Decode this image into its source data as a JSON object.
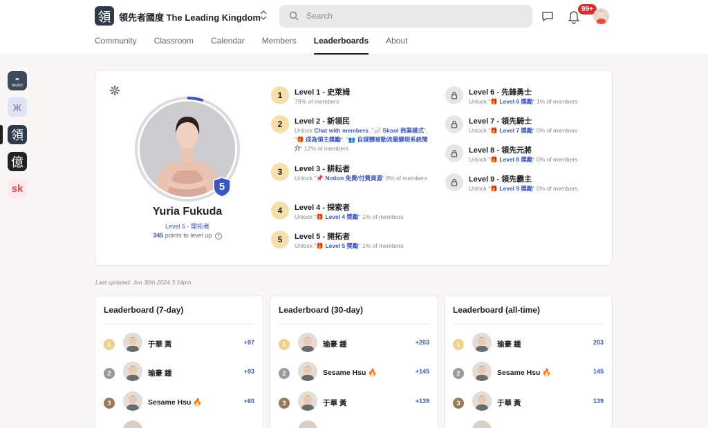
{
  "brand": {
    "logo_char": "領",
    "name": "領先者國度 The Leading Kingdom",
    "switch": "⌃⌄"
  },
  "search": {
    "placeholder": "Search"
  },
  "notifications": {
    "badge": "99+"
  },
  "tabs": [
    "Community",
    "Classroom",
    "Calendar",
    "Members",
    "Leaderboards",
    "About"
  ],
  "active_tab": "Leaderboards",
  "sidebar": [
    {
      "name": "community-icon-1",
      "glyph": "◓",
      "bg": "#3d4b5c",
      "fg": "#ffffff",
      "label": "領先時代"
    },
    {
      "name": "community-icon-2",
      "glyph": "ж",
      "bg": "#dde4f3",
      "fg": "#8a7ab8"
    },
    {
      "name": "community-icon-3",
      "glyph": "領",
      "bg": "#2f3a4a",
      "fg": "#ffffff"
    },
    {
      "name": "community-icon-4",
      "glyph": "億",
      "bg": "#222222",
      "fg": "#ffffff"
    },
    {
      "name": "community-icon-5",
      "glyph": "sk",
      "bg": "#fde9ee",
      "fg": "#e8474f"
    }
  ],
  "profile": {
    "name": "Yuria Fukuda",
    "level_label": "Level 5 - 開拓者",
    "level_num": "5",
    "points": "345",
    "points_suffix": " points to level up",
    "progress": 0.05
  },
  "levels": [
    {
      "num": "1",
      "title": "Level 1 - 史萊姆",
      "desc": [
        {
          "t": "79% of members"
        }
      ],
      "locked": false
    },
    {
      "num": "2",
      "title": "Level 2 - 新領民",
      "desc": [
        {
          "t": "Unlock "
        },
        {
          "t": "Chat with members",
          "k": 1
        },
        {
          "t": ", \"📈 "
        },
        {
          "t": "Skool 商業模式",
          "k": 1
        },
        {
          "t": "\", \"🎁 "
        },
        {
          "t": "成為領主獎勵",
          "k": 1
        },
        {
          "t": "\", \"👥 "
        },
        {
          "t": "自媒體被動流量變現系統簡介",
          "k": 1
        },
        {
          "t": "\" 12% of members"
        }
      ],
      "locked": false
    },
    {
      "num": "3",
      "title": "Level 3 - 耕耘者",
      "desc": [
        {
          "t": "Unlock \"📌 "
        },
        {
          "t": "Notion 免費/付費資源",
          "k": 1
        },
        {
          "t": "\" 6% of members"
        }
      ],
      "locked": false
    },
    {
      "num": "4",
      "title": "Level 4 - 探索者",
      "desc": [
        {
          "t": "Unlock \"🎁 "
        },
        {
          "t": "Level 4 獎勵",
          "k": 1
        },
        {
          "t": "\" 1% of members"
        }
      ],
      "locked": false
    },
    {
      "num": "5",
      "title": "Level 5 - 開拓者",
      "desc": [
        {
          "t": "Unlock \"🎁 "
        },
        {
          "t": "Level 5 獎勵",
          "k": 1
        },
        {
          "t": "\" 1% of members"
        }
      ],
      "locked": false
    },
    {
      "num": "6",
      "title": "Level 6 - 先鋒勇士",
      "desc": [
        {
          "t": "Unlock \"🎁 "
        },
        {
          "t": "Level 6 獎勵",
          "k": 1
        },
        {
          "t": "\" 1% of members"
        }
      ],
      "locked": true
    },
    {
      "num": "7",
      "title": "Level 7 - 領先騎士",
      "desc": [
        {
          "t": "Unlock \"🎁 "
        },
        {
          "t": "Level 7 獎勵",
          "k": 1
        },
        {
          "t": "\" 0% of members"
        }
      ],
      "locked": true
    },
    {
      "num": "8",
      "title": "Level 8 - 領先元將",
      "desc": [
        {
          "t": "Unlock \"🎁 "
        },
        {
          "t": "Level 8 獎勵",
          "k": 1
        },
        {
          "t": "\" 0% of members"
        }
      ],
      "locked": true
    },
    {
      "num": "9",
      "title": "Level 9 - 領先霸主",
      "desc": [
        {
          "t": "Unlock \"🎁 "
        },
        {
          "t": "Level 9 獎勵",
          "k": 1
        },
        {
          "t": "\" 0% of members"
        }
      ],
      "locked": true
    }
  ],
  "last_updated": "Last updated: Jun 30th 2024 3:14pm",
  "leaderboards": [
    {
      "title": "Leaderboard (7-day)",
      "rows": [
        {
          "rank": "1",
          "name": "于華 黃",
          "points": "+97"
        },
        {
          "rank": "2",
          "name": "瑜豪 鍾",
          "points": "+93"
        },
        {
          "rank": "3",
          "name": "Sesame Hsu 🔥",
          "points": "+60"
        }
      ]
    },
    {
      "title": "Leaderboard (30-day)",
      "rows": [
        {
          "rank": "1",
          "name": "瑜豪 鍾",
          "points": "+203"
        },
        {
          "rank": "2",
          "name": "Sesame Hsu 🔥",
          "points": "+145"
        },
        {
          "rank": "3",
          "name": "于華 黃",
          "points": "+139"
        }
      ]
    },
    {
      "title": "Leaderboard (all-time)",
      "rows": [
        {
          "rank": "1",
          "name": "瑜豪 鍾",
          "points": "203"
        },
        {
          "rank": "2",
          "name": "Sesame Hsu 🔥",
          "points": "145"
        },
        {
          "rank": "3",
          "name": "于華 黃",
          "points": "139"
        }
      ]
    }
  ]
}
